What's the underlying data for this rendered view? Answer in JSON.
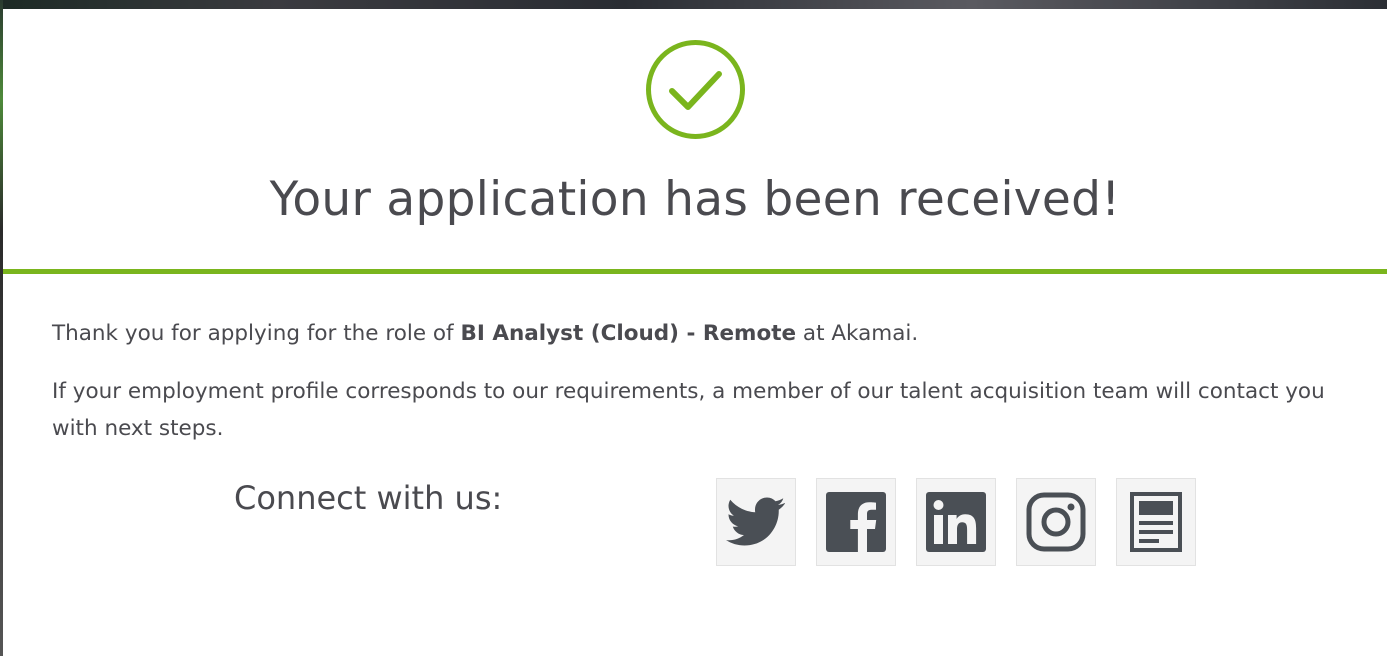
{
  "status": {
    "icon": "check-circle-icon",
    "title": "Your application has been received!"
  },
  "message": {
    "p1_prefix": "Thank you for applying for the role of ",
    "role": "BI Analyst (Cloud) - Remote",
    "p1_suffix": " at Akamai.",
    "p2": "If your employment profile corresponds to our requirements, a member of our talent acquisition team will contact you with next steps."
  },
  "connect": {
    "label": "Connect with us:",
    "links": [
      {
        "name": "twitter",
        "icon": "twitter-icon"
      },
      {
        "name": "facebook",
        "icon": "facebook-icon"
      },
      {
        "name": "linkedin",
        "icon": "linkedin-icon"
      },
      {
        "name": "instagram",
        "icon": "instagram-icon"
      },
      {
        "name": "blog",
        "icon": "blog-icon"
      }
    ]
  },
  "colors": {
    "accent": "#7ab51d",
    "text": "#4a4a4f",
    "icon": "#4a4f55"
  }
}
